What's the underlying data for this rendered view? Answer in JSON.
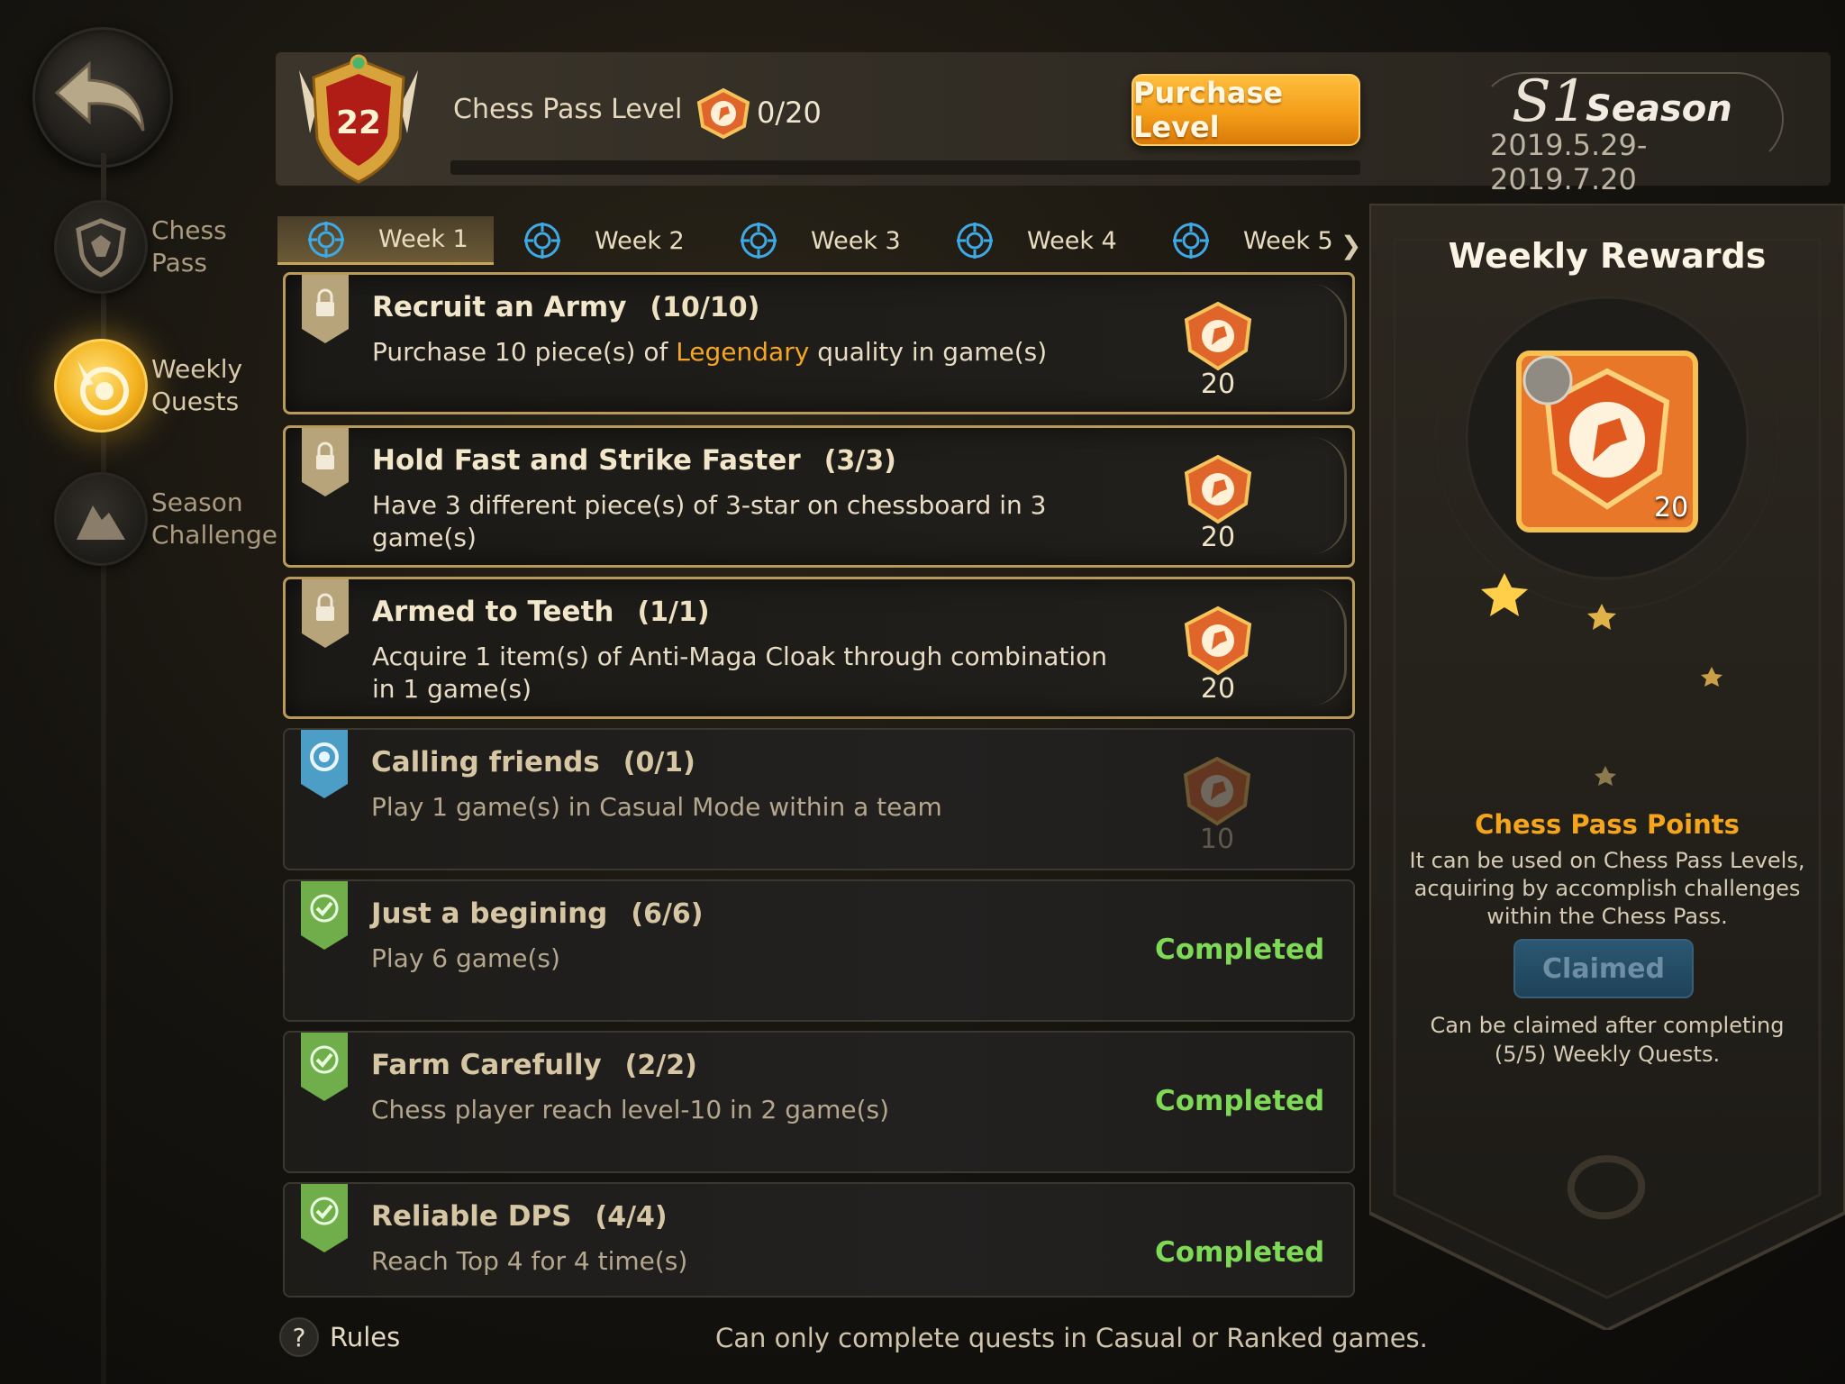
{
  "nav": {
    "items": [
      {
        "label": "Chess\nPass",
        "icon": "shield-icon",
        "active": false
      },
      {
        "label": "Weekly\nQuests",
        "icon": "target-hand-icon",
        "active": true
      },
      {
        "label": "Season\nChallenge",
        "icon": "mountain-icon",
        "active": false
      }
    ]
  },
  "header": {
    "level": "22",
    "level_label": "Chess Pass Level",
    "points": "0/20",
    "purchase_label": "Purchase Level",
    "season_num": "S1",
    "season_word": "Season",
    "season_dates": "2019.5.29-2019.7.20"
  },
  "tabs": [
    {
      "label": "Week 1",
      "active": true
    },
    {
      "label": "Week 2",
      "active": false
    },
    {
      "label": "Week 3",
      "active": false
    },
    {
      "label": "Week 4",
      "active": false
    },
    {
      "label": "Week 5",
      "active": false
    }
  ],
  "quests": [
    {
      "title": "Recruit an Army",
      "progress": "(10/10)",
      "desc_pre": "Purchase 10 piece(s) of ",
      "desc_hl": "Legendary",
      "desc_post": " quality in game(s)",
      "reward": "20",
      "state": "active"
    },
    {
      "title": "Hold Fast and Strike Faster",
      "progress": "(3/3)",
      "desc_pre": "Have 3 different piece(s) of 3-star on chessboard in 3 game(s)",
      "desc_hl": "",
      "desc_post": "",
      "reward": "20",
      "state": "active"
    },
    {
      "title": "Armed to Teeth",
      "progress": "(1/1)",
      "desc_pre": "Acquire 1 item(s) of Anti-Maga Cloak through combination in 1 game(s)",
      "desc_hl": "",
      "desc_post": "",
      "reward": "20",
      "state": "active"
    },
    {
      "title": "Calling friends",
      "progress": "(0/1)",
      "desc_pre": "Play 1 game(s) in Casual Mode within a team",
      "desc_hl": "",
      "desc_post": "",
      "reward": "10",
      "state": "pending"
    },
    {
      "title": "Just a begining",
      "progress": "(6/6)",
      "desc_pre": "Play 6 game(s)",
      "desc_hl": "",
      "desc_post": "",
      "completed_label": "Completed",
      "state": "completed"
    },
    {
      "title": "Farm Carefully",
      "progress": "(2/2)",
      "desc_pre": "Chess player reach level-10 in 2 game(s)",
      "desc_hl": "",
      "desc_post": "",
      "completed_label": "Completed",
      "state": "completed"
    },
    {
      "title": "Reliable DPS",
      "progress": "(4/4)",
      "desc_pre": "Reach Top 4 for 4 time(s)",
      "desc_hl": "",
      "desc_post": "",
      "completed_label": "Completed",
      "state": "completed"
    }
  ],
  "panel": {
    "title": "Weekly Rewards",
    "reward_count": "20",
    "points_title": "Chess Pass Points",
    "points_desc": "It can be used on Chess Pass Levels, acquiring by accomplish challenges within the Chess Pass.",
    "claimed_label": "Claimed",
    "note": "Can be claimed after completing (5/5) Weekly Quests."
  },
  "footer": {
    "rules_icon": "?",
    "rules_label": "Rules",
    "note": "Can only complete quests in Casual or Ranked games."
  },
  "colors": {
    "accent_orange": "#f4a51c",
    "completed_green": "#7ed957",
    "highlight": "#f6a623"
  }
}
